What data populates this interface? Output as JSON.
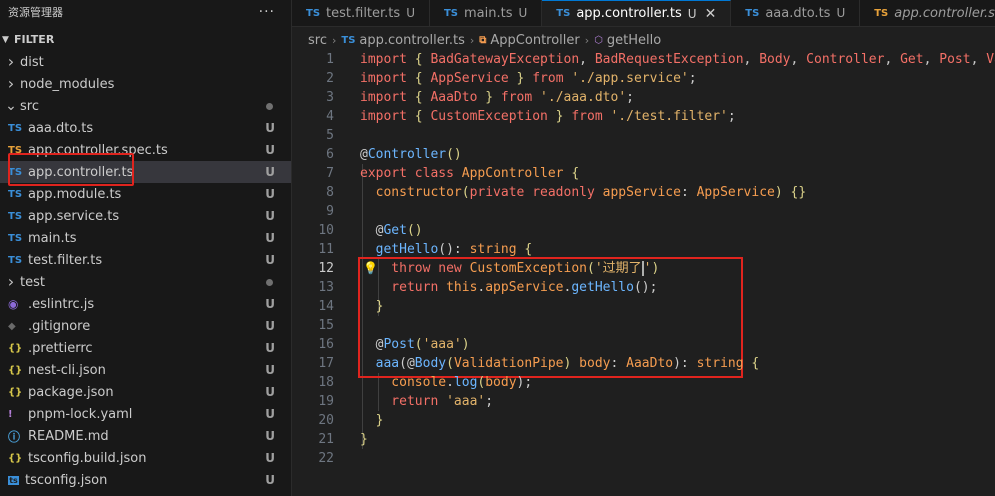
{
  "sidebar": {
    "title": "资源管理器",
    "more": "···",
    "section": "FILTER",
    "items": [
      {
        "name": "dist",
        "type": "folder",
        "open": false,
        "icon": "chevron-right-icon"
      },
      {
        "name": "node_modules",
        "type": "folder",
        "open": false,
        "icon": "chevron-right-icon"
      },
      {
        "name": "src",
        "type": "folder",
        "open": true,
        "icon": "chevron-down-icon",
        "dot": true
      },
      {
        "name": "aaa.dto.ts",
        "type": "ts",
        "icon": "TS",
        "status": "U"
      },
      {
        "name": "app.controller.spec.ts",
        "type": "spec",
        "icon": "TS",
        "status": "U"
      },
      {
        "name": "app.controller.ts",
        "type": "ts",
        "icon": "TS",
        "status": "U",
        "active": true
      },
      {
        "name": "app.module.ts",
        "type": "ts",
        "icon": "TS",
        "status": "U"
      },
      {
        "name": "app.service.ts",
        "type": "ts",
        "icon": "TS",
        "status": "U"
      },
      {
        "name": "main.ts",
        "type": "ts",
        "icon": "TS",
        "status": "U"
      },
      {
        "name": "test.filter.ts",
        "type": "ts",
        "icon": "TS",
        "status": "U"
      },
      {
        "name": "test",
        "type": "folder",
        "open": false,
        "icon": "chevron-right-icon",
        "dot": true
      },
      {
        "name": ".eslintrc.js",
        "type": "eslint",
        "icon": "◉",
        "status": "U"
      },
      {
        "name": ".gitignore",
        "type": "git",
        "icon": "◆",
        "status": "U"
      },
      {
        "name": ".prettierrc",
        "type": "json",
        "icon": "{}",
        "status": "U"
      },
      {
        "name": "nest-cli.json",
        "type": "json",
        "icon": "{}",
        "status": "U"
      },
      {
        "name": "package.json",
        "type": "json",
        "icon": "{}",
        "status": "U"
      },
      {
        "name": "pnpm-lock.yaml",
        "type": "yaml",
        "icon": "!",
        "status": "U"
      },
      {
        "name": "README.md",
        "type": "md",
        "icon": "ⓘ",
        "status": "U"
      },
      {
        "name": "tsconfig.build.json",
        "type": "json",
        "icon": "{}",
        "status": "U"
      },
      {
        "name": "tsconfig.json",
        "type": "tsconf",
        "icon": "ts",
        "status": "U"
      }
    ]
  },
  "tabs": [
    {
      "name": "test.filter.ts",
      "icon": "TS",
      "status": "U"
    },
    {
      "name": "main.ts",
      "icon": "TS",
      "status": "U"
    },
    {
      "name": "app.controller.ts",
      "icon": "TS",
      "status": "U",
      "active": true,
      "close": "✕"
    },
    {
      "name": "aaa.dto.ts",
      "icon": "TS",
      "status": "U"
    },
    {
      "name": "app.controller.spec.ts",
      "icon": "TS",
      "italic": true
    }
  ],
  "breadcrumb": {
    "folder": "src",
    "file": "app.controller.ts",
    "cls": "AppController",
    "method": "getHello"
  },
  "editor": {
    "current_line": 12,
    "lines": [
      [
        [
          "import ",
          "k-imp"
        ],
        [
          "{ ",
          "k-brace"
        ],
        [
          "BadGatewayException",
          "k-id"
        ],
        [
          ", ",
          "k-punc"
        ],
        [
          "BadRequestException",
          "k-id"
        ],
        [
          ", ",
          "k-punc"
        ],
        [
          "Body",
          "k-id"
        ],
        [
          ", ",
          "k-punc"
        ],
        [
          "Controller",
          "k-id"
        ],
        [
          ", ",
          "k-punc"
        ],
        [
          "Get",
          "k-id"
        ],
        [
          ", ",
          "k-punc"
        ],
        [
          "Post",
          "k-id"
        ],
        [
          ", ",
          "k-punc"
        ],
        [
          "Val",
          "k-id"
        ]
      ],
      [
        [
          "import ",
          "k-imp"
        ],
        [
          "{ ",
          "k-brace"
        ],
        [
          "AppService",
          "k-id"
        ],
        [
          " } ",
          "k-brace"
        ],
        [
          "from ",
          "k-imp"
        ],
        [
          "'./app.service'",
          "k-str"
        ],
        [
          ";",
          "k-punc"
        ]
      ],
      [
        [
          "import ",
          "k-imp"
        ],
        [
          "{ ",
          "k-brace"
        ],
        [
          "AaaDto",
          "k-id"
        ],
        [
          " } ",
          "k-brace"
        ],
        [
          "from ",
          "k-imp"
        ],
        [
          "'./aaa.dto'",
          "k-str"
        ],
        [
          ";",
          "k-punc"
        ]
      ],
      [
        [
          "import ",
          "k-imp"
        ],
        [
          "{ ",
          "k-brace"
        ],
        [
          "CustomException",
          "k-id"
        ],
        [
          " } ",
          "k-brace"
        ],
        [
          "from ",
          "k-imp"
        ],
        [
          "'./test.filter'",
          "k-str"
        ],
        [
          ";",
          "k-punc"
        ]
      ],
      [],
      [
        [
          "@",
          "k-punc"
        ],
        [
          "Controller",
          "k-dec"
        ],
        [
          "()",
          "k-brace"
        ]
      ],
      [
        [
          "export ",
          "k-imp"
        ],
        [
          "class ",
          "k-imp"
        ],
        [
          "AppController ",
          "k-cls"
        ],
        [
          "{",
          "k-brace"
        ]
      ],
      [
        [
          "  constructor",
          "k-cls"
        ],
        [
          "(",
          "k-brace"
        ],
        [
          "private ",
          "k-imp"
        ],
        [
          "readonly ",
          "k-imp"
        ],
        [
          "appService",
          "k-param"
        ],
        [
          ": ",
          "k-punc"
        ],
        [
          "AppService",
          "k-cls"
        ],
        [
          ") ",
          "k-brace"
        ],
        [
          "{}",
          "k-brace"
        ]
      ],
      [],
      [
        [
          "  @",
          "k-punc"
        ],
        [
          "Get",
          "k-dec"
        ],
        [
          "()",
          "k-brace"
        ]
      ],
      [
        [
          "  getHello",
          "k-fn"
        ],
        [
          "(): ",
          "k-punc"
        ],
        [
          "string ",
          "k-cls"
        ],
        [
          "{",
          "k-brace"
        ]
      ],
      [
        [
          "    throw ",
          "k-imp"
        ],
        [
          "new ",
          "k-imp"
        ],
        [
          "CustomException",
          "k-cls"
        ],
        [
          "(",
          "k-brace"
        ],
        [
          "'过期了",
          "k-str"
        ],
        [
          "|",
          "cursor"
        ],
        [
          "'",
          "k-str"
        ],
        [
          ")",
          "k-brace"
        ]
      ],
      [
        [
          "    return ",
          "k-imp"
        ],
        [
          "this",
          "k-this"
        ],
        [
          ".",
          "k-punc"
        ],
        [
          "appService",
          "k-param"
        ],
        [
          ".",
          "k-punc"
        ],
        [
          "getHello",
          "k-fn"
        ],
        [
          "();",
          "k-punc"
        ]
      ],
      [
        [
          "  }",
          "k-brace"
        ]
      ],
      [],
      [
        [
          "  @",
          "k-punc"
        ],
        [
          "Post",
          "k-dec"
        ],
        [
          "(",
          "k-brace"
        ],
        [
          "'aaa'",
          "k-str"
        ],
        [
          ")",
          "k-brace"
        ]
      ],
      [
        [
          "  aaa",
          "k-fn"
        ],
        [
          "(@",
          "k-punc"
        ],
        [
          "Body",
          "k-dec"
        ],
        [
          "(",
          "k-brace"
        ],
        [
          "ValidationPipe",
          "k-cls"
        ],
        [
          ") ",
          "k-brace"
        ],
        [
          "body",
          "k-param"
        ],
        [
          ": ",
          "k-punc"
        ],
        [
          "AaaDto",
          "k-cls"
        ],
        [
          "): ",
          "k-punc"
        ],
        [
          "string ",
          "k-cls"
        ],
        [
          "{",
          "k-brace"
        ]
      ],
      [
        [
          "    console",
          "k-cls"
        ],
        [
          ".",
          "k-punc"
        ],
        [
          "log",
          "k-fn"
        ],
        [
          "(",
          "k-brace"
        ],
        [
          "body",
          "k-param"
        ],
        [
          ");",
          "k-punc"
        ]
      ],
      [
        [
          "    return ",
          "k-imp"
        ],
        [
          "'aaa'",
          "k-str"
        ],
        [
          ";",
          "k-punc"
        ]
      ],
      [
        [
          "  }",
          "k-brace"
        ]
      ],
      [
        [
          "}",
          "k-brace"
        ]
      ],
      []
    ]
  }
}
